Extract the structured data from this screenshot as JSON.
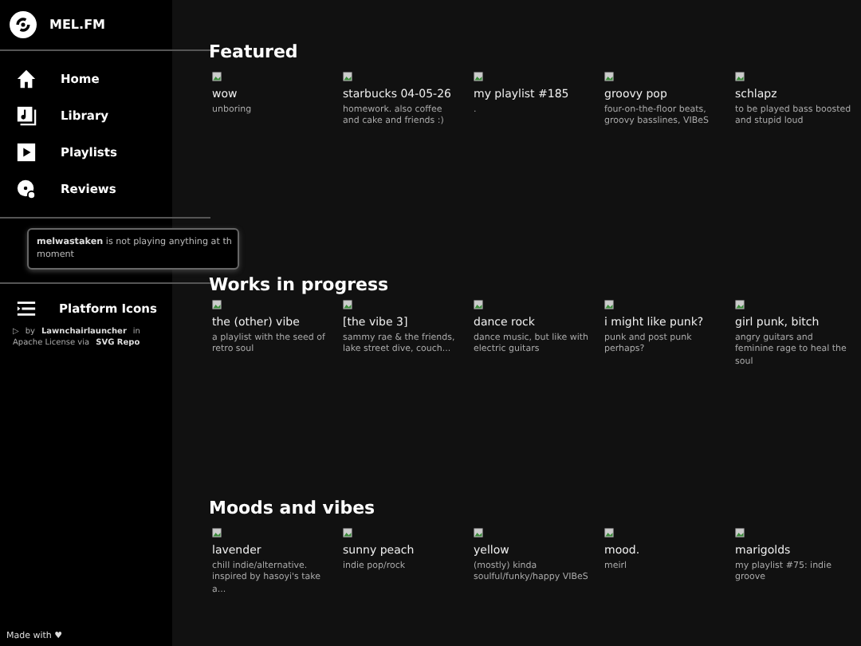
{
  "brand": "MEL.FM",
  "nav": [
    {
      "label": "Home",
      "selected": false
    },
    {
      "label": "Library",
      "selected": false
    },
    {
      "label": "Playlists",
      "selected": false
    },
    {
      "label": "Reviews",
      "selected": false
    }
  ],
  "now_playing": {
    "user": "melwastaken",
    "text": "is not playing anything at th",
    "text_2": "moment"
  },
  "platform_icons": {
    "label": "Platform Icons",
    "credit_mark": "▷",
    "credit_by": "by",
    "credit_author": "Lawnchairlauncher",
    "credit_in": "in",
    "credit_license": "Apache License via",
    "credit_source": "SVG Repo"
  },
  "footer": "Made with ♥",
  "sections": [
    {
      "title": "Featured",
      "items": [
        {
          "name": "wow",
          "description": "unboring"
        },
        {
          "name": "starbucks 04-05-26",
          "description": "homework. also coffee and cake and friends :)"
        },
        {
          "name": "my playlist #185",
          "description": "."
        },
        {
          "name": "groovy pop",
          "description": "four-on-the-floor beats, groovy basslines, VIBeS"
        },
        {
          "name": "schlapz",
          "description": "to be played bass boosted and stupid loud"
        }
      ]
    },
    {
      "title": "Works in progress",
      "items": [
        {
          "name": "the (other) vibe",
          "description": "a playlist with the seed of retro soul"
        },
        {
          "name": "[the vibe 3]",
          "description": "sammy rae & the friends, lake street dive, couch..."
        },
        {
          "name": "dance rock",
          "description": "dance music, but like with electric guitars"
        },
        {
          "name": "i might like punk?",
          "description": "punk and post punk perhaps?"
        },
        {
          "name": "girl punk, bitch",
          "description": "angry guitars and feminine rage to heal the soul"
        }
      ]
    },
    {
      "title": "Moods and vibes",
      "items": [
        {
          "name": "lavender",
          "description": "chill indie/alternative. inspired by hasoyi's take a..."
        },
        {
          "name": "sunny peach",
          "description": "indie pop/rock"
        },
        {
          "name": "yellow",
          "description": "(mostly) kinda soulful/funky/happy VIBeS"
        },
        {
          "name": "mood.",
          "description": "meirl"
        },
        {
          "name": "marigolds",
          "description": "my playlist #75: indie groove"
        }
      ]
    }
  ]
}
